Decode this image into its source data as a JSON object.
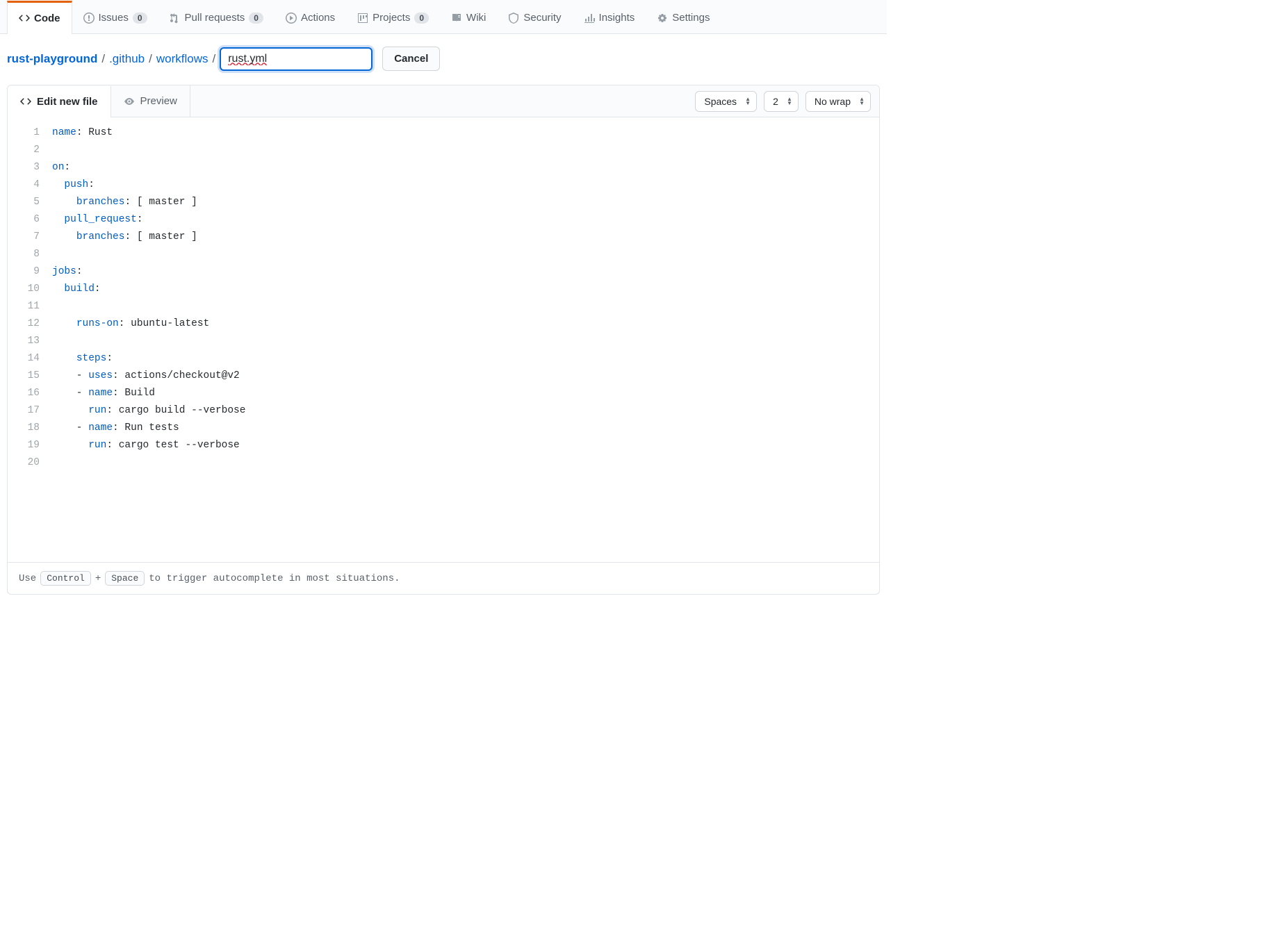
{
  "nav": {
    "code": "Code",
    "issues": "Issues",
    "issues_count": "0",
    "pulls": "Pull requests",
    "pulls_count": "0",
    "actions": "Actions",
    "projects": "Projects",
    "projects_count": "0",
    "wiki": "Wiki",
    "security": "Security",
    "insights": "Insights",
    "settings": "Settings"
  },
  "breadcrumb": {
    "repo": "rust-playground",
    "dir1": ".github",
    "dir2": "workflows",
    "filename_value": "rust.yml",
    "cancel": "Cancel"
  },
  "tabs": {
    "edit": "Edit new file",
    "preview": "Preview"
  },
  "toolbar": {
    "indent_mode": "Spaces",
    "indent_size": "2",
    "wrap_mode": "No wrap"
  },
  "code": {
    "lines": [
      [
        {
          "t": "key",
          "v": "name"
        },
        {
          "t": "p",
          "v": ": Rust"
        }
      ],
      [],
      [
        {
          "t": "key",
          "v": "on"
        },
        {
          "t": "p",
          "v": ":"
        }
      ],
      [
        {
          "t": "p",
          "v": "  "
        },
        {
          "t": "key",
          "v": "push"
        },
        {
          "t": "p",
          "v": ":"
        }
      ],
      [
        {
          "t": "p",
          "v": "    "
        },
        {
          "t": "key",
          "v": "branches"
        },
        {
          "t": "p",
          "v": ": [ master ]"
        }
      ],
      [
        {
          "t": "p",
          "v": "  "
        },
        {
          "t": "key",
          "v": "pull_request"
        },
        {
          "t": "p",
          "v": ":"
        }
      ],
      [
        {
          "t": "p",
          "v": "    "
        },
        {
          "t": "key",
          "v": "branches"
        },
        {
          "t": "p",
          "v": ": [ master ]"
        }
      ],
      [],
      [
        {
          "t": "key",
          "v": "jobs"
        },
        {
          "t": "p",
          "v": ":"
        }
      ],
      [
        {
          "t": "p",
          "v": "  "
        },
        {
          "t": "key",
          "v": "build"
        },
        {
          "t": "p",
          "v": ":"
        }
      ],
      [],
      [
        {
          "t": "p",
          "v": "    "
        },
        {
          "t": "key",
          "v": "runs-on"
        },
        {
          "t": "p",
          "v": ": ubuntu-latest"
        }
      ],
      [],
      [
        {
          "t": "p",
          "v": "    "
        },
        {
          "t": "key",
          "v": "steps"
        },
        {
          "t": "p",
          "v": ":"
        }
      ],
      [
        {
          "t": "p",
          "v": "    - "
        },
        {
          "t": "key",
          "v": "uses"
        },
        {
          "t": "p",
          "v": ": actions/checkout@v2"
        }
      ],
      [
        {
          "t": "p",
          "v": "    - "
        },
        {
          "t": "key",
          "v": "name"
        },
        {
          "t": "p",
          "v": ": Build"
        }
      ],
      [
        {
          "t": "p",
          "v": "      "
        },
        {
          "t": "key",
          "v": "run"
        },
        {
          "t": "p",
          "v": ": cargo build --verbose"
        }
      ],
      [
        {
          "t": "p",
          "v": "    - "
        },
        {
          "t": "key",
          "v": "name"
        },
        {
          "t": "p",
          "v": ": Run tests"
        }
      ],
      [
        {
          "t": "p",
          "v": "      "
        },
        {
          "t": "key",
          "v": "run"
        },
        {
          "t": "p",
          "v": ": cargo test --verbose"
        }
      ],
      []
    ]
  },
  "footer": {
    "pre": "Use",
    "key1": "Control",
    "plus": "+",
    "key2": "Space",
    "post": "to trigger autocomplete in most situations."
  }
}
